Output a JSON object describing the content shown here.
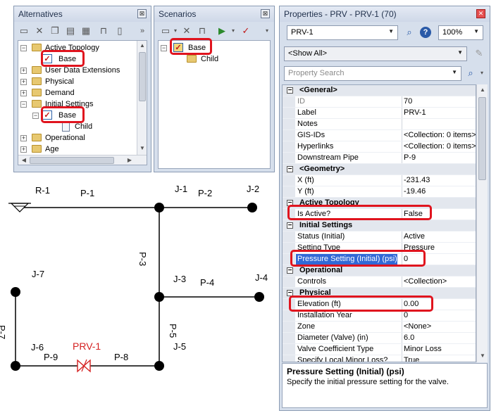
{
  "alternatives": {
    "title": "Alternatives",
    "more": "»",
    "tree": [
      {
        "label": "Active Topology",
        "type": "folder",
        "expand": "−"
      },
      {
        "label": "Base",
        "type": "checked"
      },
      {
        "label": "User Data Extensions",
        "type": "folder",
        "expand": "+"
      },
      {
        "label": "Physical",
        "type": "folder",
        "expand": "+"
      },
      {
        "label": "Demand",
        "type": "folder",
        "expand": "+"
      },
      {
        "label": "Initial Settings",
        "type": "folder",
        "expand": "−"
      },
      {
        "label": "Base",
        "type": "checked"
      },
      {
        "label": "Child",
        "type": "doc"
      },
      {
        "label": "Operational",
        "type": "folder",
        "expand": "+"
      },
      {
        "label": "Age",
        "type": "folder",
        "expand": "+"
      }
    ]
  },
  "scenarios": {
    "title": "Scenarios",
    "tree": [
      {
        "label": "Base",
        "type": "checked",
        "expand": "−"
      },
      {
        "label": "Child",
        "type": "folder"
      }
    ]
  },
  "properties": {
    "title": "Properties - PRV - PRV-1 (70)",
    "element_select": "PRV-1",
    "zoom": "100%",
    "filter": "<Show All>",
    "search_placeholder": "Property Search",
    "rows": [
      {
        "kind": "cat",
        "name": "<General>"
      },
      {
        "kind": "prop",
        "name": "ID",
        "value": "70",
        "readonly": true
      },
      {
        "kind": "prop",
        "name": "Label",
        "value": "PRV-1"
      },
      {
        "kind": "prop",
        "name": "Notes",
        "value": ""
      },
      {
        "kind": "prop",
        "name": "GIS-IDs",
        "value": "<Collection: 0 items>"
      },
      {
        "kind": "prop",
        "name": "Hyperlinks",
        "value": "<Collection: 0 items>"
      },
      {
        "kind": "prop",
        "name": "Downstream Pipe",
        "value": "P-9"
      },
      {
        "kind": "cat",
        "name": "<Geometry>"
      },
      {
        "kind": "prop",
        "name": "X (ft)",
        "value": "-231.43"
      },
      {
        "kind": "prop",
        "name": "Y (ft)",
        "value": "-19.46"
      },
      {
        "kind": "cat",
        "name": "Active Topology"
      },
      {
        "kind": "prop",
        "name": "Is Active?",
        "value": "False"
      },
      {
        "kind": "cat",
        "name": "Initial Settings"
      },
      {
        "kind": "prop",
        "name": "Status (Initial)",
        "value": "Active"
      },
      {
        "kind": "prop",
        "name": "Setting Type",
        "value": "Pressure"
      },
      {
        "kind": "prop",
        "name": "Pressure Setting (Initial) (psi)",
        "value": "0",
        "selected": true
      },
      {
        "kind": "cat",
        "name": "Operational"
      },
      {
        "kind": "prop",
        "name": "Controls",
        "value": "<Collection>"
      },
      {
        "kind": "cat",
        "name": "Physical"
      },
      {
        "kind": "prop",
        "name": "Elevation (ft)",
        "value": "0.00"
      },
      {
        "kind": "prop",
        "name": "Installation Year",
        "value": "0"
      },
      {
        "kind": "prop",
        "name": "Zone",
        "value": "<None>"
      },
      {
        "kind": "prop",
        "name": "Diameter (Valve) (in)",
        "value": "6.0"
      },
      {
        "kind": "prop",
        "name": "Valve Coefficient Type",
        "value": "Minor Loss"
      },
      {
        "kind": "prop",
        "name": "Specify Local Minor Loss?",
        "value": "True"
      }
    ],
    "help_title": "Pressure Setting (Initial) (psi)",
    "help_text": "Specify the initial pressure setting for the valve."
  },
  "network": {
    "labels": {
      "r1": "R-1",
      "j1": "J-1",
      "j2": "J-2",
      "j3": "J-3",
      "j4": "J-4",
      "j5": "J-5",
      "j6": "J-6",
      "j7": "J-7",
      "prv1": "PRV-1",
      "p1": "P-1",
      "p2": "P-2",
      "p3": "P-3",
      "p4": "P-4",
      "p5": "P-5",
      "p7": "P-7",
      "p8": "P-8",
      "p9": "P-9"
    },
    "prv_color": "#d42020"
  }
}
